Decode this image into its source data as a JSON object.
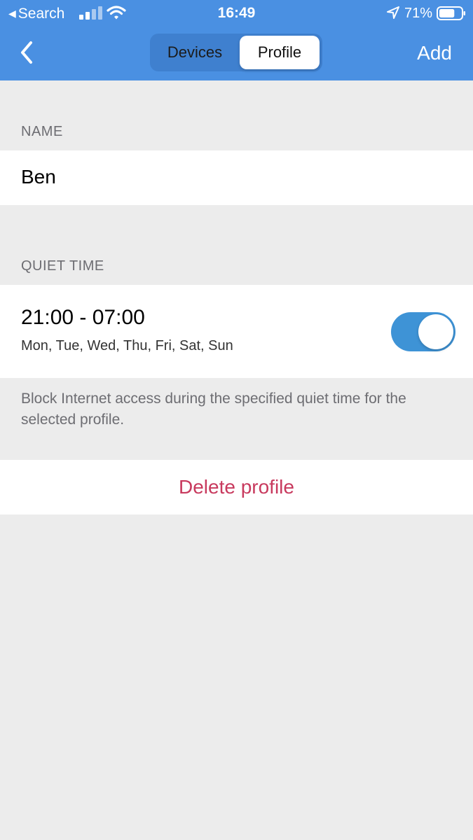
{
  "status_bar": {
    "back_app": "Search",
    "time": "16:49",
    "battery_percent": "71%",
    "battery_level": 0.71,
    "icons": [
      "signal-icon",
      "wifi-icon",
      "location-icon",
      "battery-icon"
    ]
  },
  "nav": {
    "back_icon": "chevron-left-icon",
    "tabs": [
      {
        "label": "Devices",
        "selected": false
      },
      {
        "label": "Profile",
        "selected": true
      }
    ],
    "add_label": "Add"
  },
  "name_section": {
    "header": "NAME",
    "value": "Ben"
  },
  "quiet_time": {
    "header": "QUIET TIME",
    "time_range": "21:00 - 07:00",
    "days": "Mon, Tue, Wed, Thu, Fri, Sat, Sun",
    "enabled": true,
    "footer": "Block Internet access during the specified quiet time for the selected profile."
  },
  "actions": {
    "delete_label": "Delete profile"
  },
  "colors": {
    "header_bg": "#4a90e2",
    "page_bg": "#ececec",
    "toggle_on": "#3e93d6",
    "destructive": "#c83a5e"
  }
}
